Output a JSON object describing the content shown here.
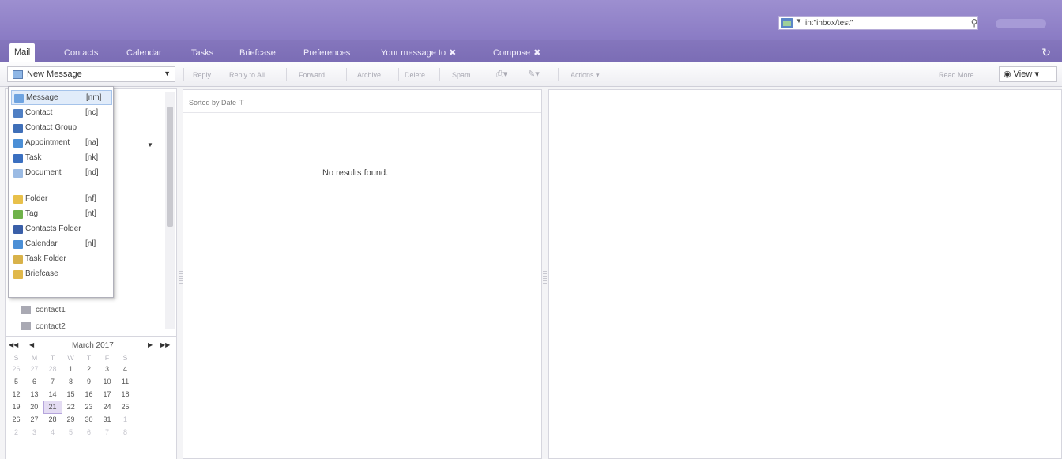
{
  "header": {
    "search_query": "in:\"inbox/test\"",
    "search_type_icon": "mail-search-icon"
  },
  "tabs": [
    {
      "label": "Mail"
    },
    {
      "label": "Contacts"
    },
    {
      "label": "Calendar"
    },
    {
      "label": "Tasks"
    },
    {
      "label": "Briefcase"
    },
    {
      "label": "Preferences"
    },
    {
      "label": "Your message to",
      "closable": true
    },
    {
      "label": "Compose",
      "closable": true
    }
  ],
  "toolbar": {
    "new_message_label": "New Message",
    "reply": "Reply",
    "reply_all": "Reply to All",
    "forward": "Forward",
    "archive": "Archive",
    "delete": "Delete",
    "spam": "Spam",
    "actions": "Actions",
    "read_more": "Read More",
    "view": "View"
  },
  "new_menu": [
    {
      "label": "Message",
      "shortcut": "[nm]",
      "icon": "message-icon",
      "color": "#6ea3e0"
    },
    {
      "label": "Contact",
      "shortcut": "[nc]",
      "icon": "contact-icon",
      "color": "#4f7fc4"
    },
    {
      "label": "Contact Group",
      "shortcut": "",
      "icon": "contact-group-icon",
      "color": "#3f6fb8"
    },
    {
      "label": "Appointment",
      "shortcut": "[na]",
      "icon": "appointment-icon",
      "color": "#4b8fd6"
    },
    {
      "label": "Task",
      "shortcut": "[nk]",
      "icon": "task-icon",
      "color": "#3a6fc0"
    },
    {
      "label": "Document",
      "shortcut": "[nd]",
      "icon": "document-icon",
      "color": "#9bbbe4"
    },
    {
      "label": "Folder",
      "shortcut": "[nf]",
      "icon": "folder-icon",
      "color": "#e8c04a"
    },
    {
      "label": "Tag",
      "shortcut": "[nt]",
      "icon": "tag-icon",
      "color": "#6fb24a"
    },
    {
      "label": "Contacts Folder",
      "shortcut": "",
      "icon": "contacts-folder-icon",
      "color": "#3a5fa8"
    },
    {
      "label": "Calendar",
      "shortcut": "[nl]",
      "icon": "calendar-icon",
      "color": "#4b8fd6"
    },
    {
      "label": "Task Folder",
      "shortcut": "",
      "icon": "task-folder-icon",
      "color": "#d8b24a"
    },
    {
      "label": "Briefcase",
      "shortcut": "",
      "icon": "briefcase-icon",
      "color": "#e0b84a"
    }
  ],
  "folders": [
    {
      "label": "contact1"
    },
    {
      "label": "contact2"
    }
  ],
  "calendar": {
    "month": "March 2017",
    "days_of_week": [
      "S",
      "M",
      "T",
      "W",
      "T",
      "F",
      "S"
    ],
    "weeks": [
      [
        {
          "d": "26",
          "o": true
        },
        {
          "d": "27",
          "o": true
        },
        {
          "d": "28",
          "o": true
        },
        {
          "d": "1"
        },
        {
          "d": "2"
        },
        {
          "d": "3"
        },
        {
          "d": "4"
        }
      ],
      [
        {
          "d": "5"
        },
        {
          "d": "6"
        },
        {
          "d": "7"
        },
        {
          "d": "8"
        },
        {
          "d": "9"
        },
        {
          "d": "10"
        },
        {
          "d": "11"
        }
      ],
      [
        {
          "d": "12"
        },
        {
          "d": "13"
        },
        {
          "d": "14"
        },
        {
          "d": "15"
        },
        {
          "d": "16"
        },
        {
          "d": "17"
        },
        {
          "d": "18"
        }
      ],
      [
        {
          "d": "19"
        },
        {
          "d": "20"
        },
        {
          "d": "21",
          "today": true
        },
        {
          "d": "22"
        },
        {
          "d": "23"
        },
        {
          "d": "24"
        },
        {
          "d": "25"
        }
      ],
      [
        {
          "d": "26"
        },
        {
          "d": "27"
        },
        {
          "d": "28"
        },
        {
          "d": "29"
        },
        {
          "d": "30"
        },
        {
          "d": "31"
        },
        {
          "d": "1",
          "o": true
        }
      ],
      [
        {
          "d": "2",
          "o": true
        },
        {
          "d": "3",
          "o": true
        },
        {
          "d": "4",
          "o": true
        },
        {
          "d": "5",
          "o": true
        },
        {
          "d": "6",
          "o": true
        },
        {
          "d": "7",
          "o": true
        },
        {
          "d": "8",
          "o": true
        }
      ]
    ]
  },
  "list": {
    "sort_label": "Sorted by Date",
    "empty_text": "No results found."
  }
}
